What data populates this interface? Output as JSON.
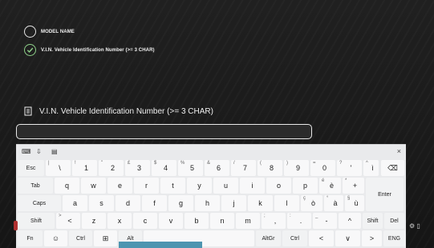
{
  "steps": [
    {
      "label": "MODEL NAME",
      "state": "pending"
    },
    {
      "label": "V.I.N. Vehicle Identification Number (>= 3 CHAR)",
      "state": "done"
    }
  ],
  "field": {
    "title": "V.I.N. Vehicle Identification Number (>= 3 CHAR)",
    "value": ""
  },
  "keyboard": {
    "close": "×",
    "row1": [
      {
        "p": "Esc"
      },
      {
        "s": "|",
        "p": "\\"
      },
      {
        "s": "!",
        "p": "1"
      },
      {
        "s": "\"",
        "p": "2"
      },
      {
        "s": "£",
        "p": "3"
      },
      {
        "s": "$",
        "p": "4"
      },
      {
        "s": "%",
        "p": "5"
      },
      {
        "s": "&",
        "p": "6"
      },
      {
        "s": "/",
        "p": "7"
      },
      {
        "s": "(",
        "p": "8"
      },
      {
        "s": ")",
        "p": "9"
      },
      {
        "s": "=",
        "p": "0"
      },
      {
        "s": "?",
        "p": "'"
      },
      {
        "s": "^",
        "p": "ì"
      },
      {
        "p": "⌫"
      }
    ],
    "row2": [
      {
        "p": "Tab"
      },
      {
        "p": "q"
      },
      {
        "p": "w"
      },
      {
        "p": "e"
      },
      {
        "p": "r"
      },
      {
        "p": "t"
      },
      {
        "p": "y"
      },
      {
        "p": "u"
      },
      {
        "p": "i"
      },
      {
        "p": "o"
      },
      {
        "p": "p"
      },
      {
        "s": "é",
        "p": "è"
      },
      {
        "s": "*",
        "p": "+"
      }
    ],
    "enter": "Enter",
    "row3": [
      {
        "p": "Caps"
      },
      {
        "p": "a"
      },
      {
        "p": "s"
      },
      {
        "p": "d"
      },
      {
        "p": "f"
      },
      {
        "p": "g"
      },
      {
        "p": "h"
      },
      {
        "p": "j"
      },
      {
        "p": "k"
      },
      {
        "p": "l"
      },
      {
        "s": "ç",
        "p": "ò"
      },
      {
        "s": "°",
        "p": "à"
      },
      {
        "s": "§",
        "p": "ù"
      }
    ],
    "row4": [
      {
        "p": "Shift"
      },
      {
        "s": ">",
        "p": "<"
      },
      {
        "p": "z"
      },
      {
        "p": "x"
      },
      {
        "p": "c"
      },
      {
        "p": "v"
      },
      {
        "p": "b"
      },
      {
        "p": "n"
      },
      {
        "p": "m"
      },
      {
        "s": ";",
        "p": ","
      },
      {
        "s": ":",
        "p": "."
      },
      {
        "s": "_",
        "p": "-"
      },
      {
        "p": "^"
      },
      {
        "p": "Shift"
      },
      {
        "p": "Del"
      }
    ],
    "row5": [
      {
        "p": "Fn"
      },
      {
        "p": "☺"
      },
      {
        "p": "Ctrl"
      },
      {
        "p": "⊞"
      },
      {
        "p": "Alt"
      },
      {
        "p": ""
      },
      {
        "p": "AltGr"
      },
      {
        "p": "Ctrl"
      },
      {
        "p": "<"
      },
      {
        "p": "∨"
      },
      {
        "p": ">"
      },
      {
        "p": "ENG"
      }
    ]
  }
}
